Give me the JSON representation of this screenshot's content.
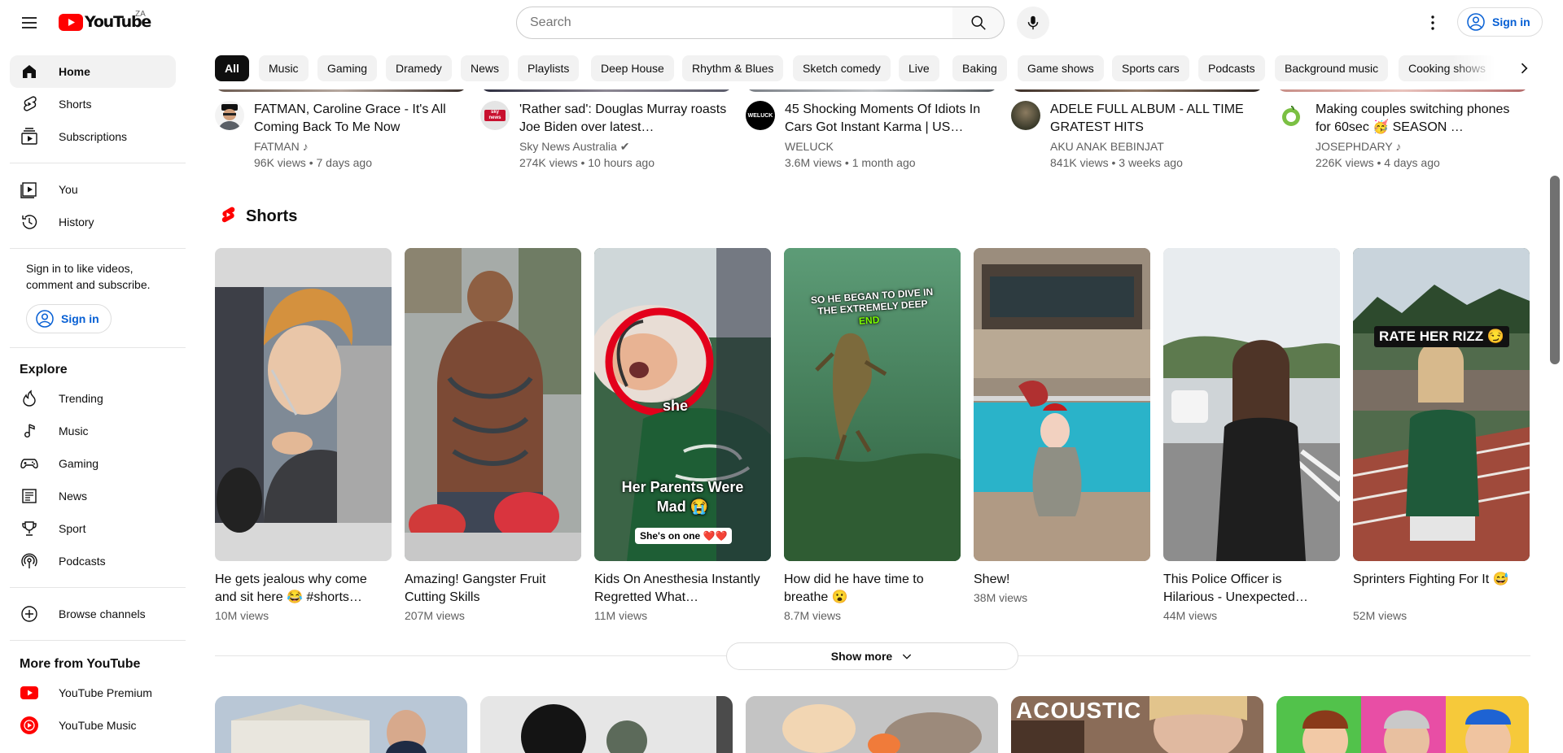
{
  "masthead": {
    "logo_text": "YouTube",
    "country_code": "ZA",
    "search_placeholder": "Search",
    "signin_label": "Sign in"
  },
  "sidebar": {
    "primary": [
      {
        "label": "Home",
        "icon": "home-icon",
        "active": true
      },
      {
        "label": "Shorts",
        "icon": "shorts-icon"
      },
      {
        "label": "Subscriptions",
        "icon": "subscriptions-icon"
      }
    ],
    "you": [
      {
        "label": "You",
        "icon": "you-icon"
      },
      {
        "label": "History",
        "icon": "history-icon"
      }
    ],
    "signin_prompt": "Sign in to like videos, comment and subscribe.",
    "signin_label": "Sign in",
    "explore_heading": "Explore",
    "explore": [
      {
        "label": "Trending",
        "icon": "trending-icon"
      },
      {
        "label": "Music",
        "icon": "music-icon"
      },
      {
        "label": "Gaming",
        "icon": "gaming-icon"
      },
      {
        "label": "News",
        "icon": "news-icon"
      },
      {
        "label": "Sport",
        "icon": "sport-icon"
      },
      {
        "label": "Podcasts",
        "icon": "podcasts-icon"
      }
    ],
    "browse_channels": "Browse channels",
    "more_heading": "More from YouTube",
    "more": [
      {
        "label": "YouTube Premium",
        "icon": "youtube-premium-icon"
      },
      {
        "label": "YouTube Music",
        "icon": "youtube-music-icon"
      }
    ]
  },
  "chips": [
    "All",
    "Music",
    "Gaming",
    "Dramedy",
    "News",
    "Playlists",
    "Deep House",
    "Rhythm & Blues",
    "Sketch comedy",
    "Live",
    "Baking",
    "Game shows",
    "Sports cars",
    "Podcasts",
    "Background music",
    "Cooking shows"
  ],
  "videos": [
    {
      "title": "FATMAN, Caroline Grace - It's All Coming Back To Me Now",
      "channel": "FATMAN ♪",
      "meta": "96K views • 7 days ago"
    },
    {
      "title": "'Rather sad': Douglas Murray roasts Joe Biden over latest…",
      "channel": "Sky News Australia ✔",
      "meta": "274K views • 10 hours ago"
    },
    {
      "title": "45 Shocking Moments Of Idiots In Cars Got Instant Karma | US…",
      "channel": "WELUCK",
      "meta": "3.6M views • 1 month ago"
    },
    {
      "title": "ADELE FULL ALBUM - ALL TIME GRATEST HITS",
      "channel": "AKU ANAK BEBINJAT",
      "meta": "841K views • 3 weeks ago"
    },
    {
      "title": "Making couples switching phones for 60sec 🥳 SEASON …",
      "channel": "JOSEPHDARY ♪",
      "meta": "226K views • 4 days ago"
    }
  ],
  "avatar_texts": {
    "weluck": "WELUCK",
    "sky": "sky news"
  },
  "shorts": {
    "heading": "Shorts",
    "items": [
      {
        "title": "He gets jealous why come and sit here 😂 #shorts…",
        "views": "10M views"
      },
      {
        "title": "Amazing! Gangster Fruit Cutting Skills",
        "views": "207M views"
      },
      {
        "title": "Kids On Anesthesia Instantly Regretted What…",
        "views": "11M views",
        "overlay": "Her Parents Were Mad 😭",
        "overlay2": "she",
        "overlay3": "She's on one ❤️❤️"
      },
      {
        "title": "How did he have time to breathe 😮",
        "views": "8.7M views",
        "overlay": "SO HE BEGAN TO DIVE IN THE EXTREMELY DEEP",
        "overlay2": "END"
      },
      {
        "title": "Shew!",
        "views": "38M views"
      },
      {
        "title": "This Police Officer is Hilarious - Unexpected…",
        "views": "44M views"
      },
      {
        "title": "Sprinters Fighting For It 😅",
        "views": "52M views",
        "overlay": "RATE HER RIZZ 😏"
      }
    ],
    "show_more": "Show more"
  },
  "bottom_thumbs": {
    "acoustic": "ACOUSTIC"
  },
  "colors": {
    "brand_red": "#ff0000",
    "link_blue": "#065fd4",
    "chip_bg": "#f2f2f2",
    "text_secondary": "#606060"
  }
}
